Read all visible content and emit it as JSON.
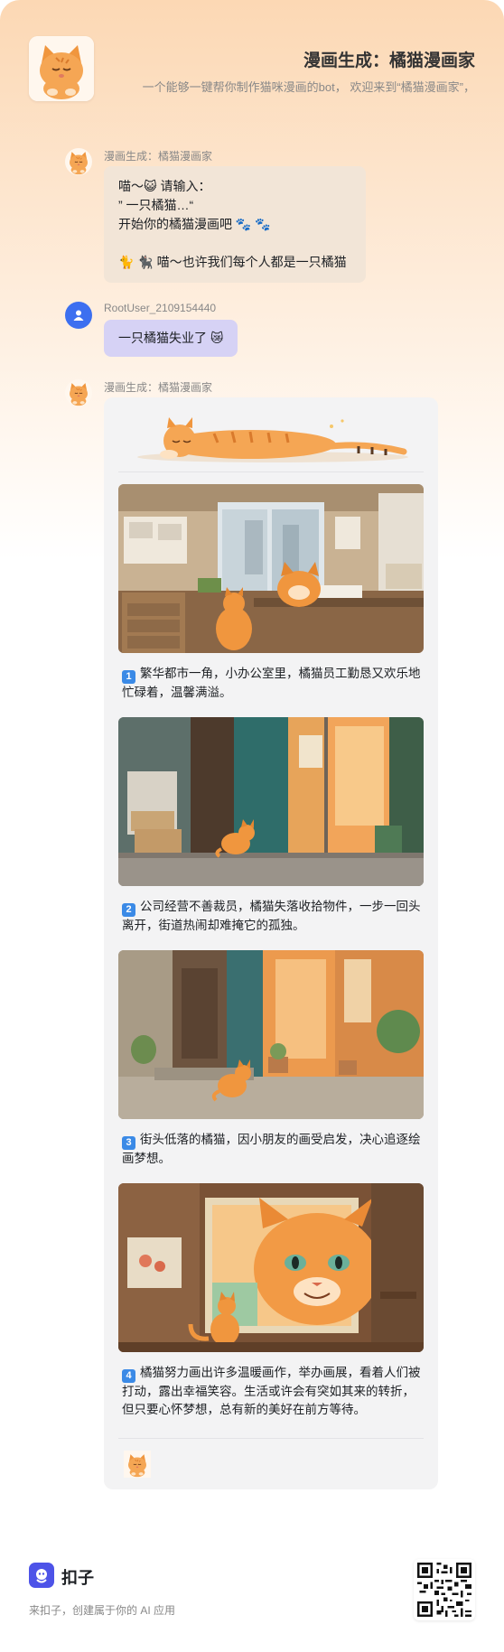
{
  "header": {
    "title": "漫画生成：橘猫漫画家",
    "description": "一个能够一键帮你制作猫咪漫画的bot， 欢迎来到“橘猫漫画家”，"
  },
  "messages": [
    {
      "sender": "漫画生成：橘猫漫画家",
      "lines": [
        "喵～😺 请输入：",
        "” 一只橘猫…“",
        "开始你的橘猫漫画吧 🐾 🐾",
        "",
        "🐈 🐈‍⬛ 喵～也许我们每个人都是一只橘猫"
      ]
    },
    {
      "sender": "RootUser_2109154440",
      "text": "一只橘猫失业了 😿"
    },
    {
      "sender": "漫画生成：橘猫漫画家",
      "panels": [
        {
          "num": "1",
          "caption": "繁华都市一角，小办公室里，橘猫员工勤恳又欢乐地忙碌着，温馨满溢。"
        },
        {
          "num": "2",
          "caption": "公司经营不善裁员，橘猫失落收拾物件，一步一回头离开，街道热闹却难掩它的孤独。"
        },
        {
          "num": "3",
          "caption": "街头低落的橘猫，因小朋友的画受启发，决心追逐绘画梦想。"
        },
        {
          "num": "4",
          "caption": "橘猫努力画出许多温暖画作，举办画展，看着人们被打动，露出幸福笑容。生活或许会有突如其来的转折，但只要心怀梦想，总有新的美好在前方等待。"
        }
      ]
    }
  ],
  "footer": {
    "brand": "扣子",
    "slogan": "来扣子，创建属于你的 AI 应用"
  },
  "colors": {
    "accent": "#4d53e8",
    "user_bubble": "#d6d2f5",
    "bot_bubble": "#f2e5d7",
    "number_badge": "#3b8ae6"
  }
}
